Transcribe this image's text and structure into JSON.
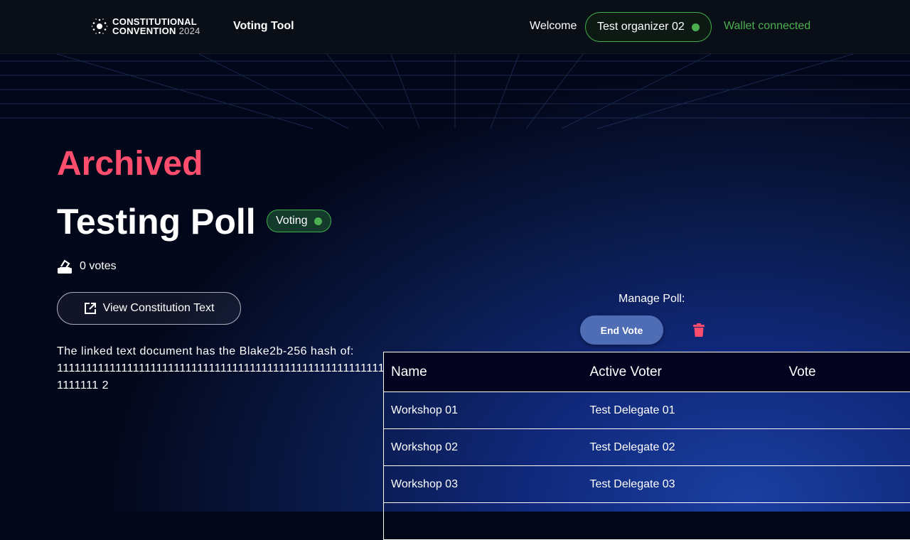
{
  "header": {
    "logo_line1": "CONSTITUTIONAL",
    "logo_line2": "CONVENTION",
    "logo_year": "2024",
    "app_name": "Voting Tool",
    "welcome": "Welcome",
    "user": "Test organizer 02",
    "wallet_status": "Wallet connected"
  },
  "poll": {
    "status_heading": "Archived",
    "title": "Testing Poll",
    "badge": "Voting",
    "votes": "0 votes",
    "view_button": "View Constitution Text",
    "hash_label": "The linked text document has the Blake2b-256 hash of:",
    "hash": "111111111111111111111111111111111111111111111111111111111111111 2"
  },
  "manage": {
    "label": "Manage Poll:",
    "end_vote": "End Vote"
  },
  "table": {
    "headers": [
      "Name",
      "Active Voter",
      "Vote"
    ],
    "rows": [
      [
        "Workshop 01",
        "Test Delegate 01",
        ""
      ],
      [
        "Workshop 02",
        "Test Delegate 02",
        ""
      ],
      [
        "Workshop 03",
        "Test Delegate 03",
        ""
      ],
      [
        "",
        "",
        ""
      ]
    ]
  },
  "colors": {
    "accent_red": "#ff4d6d",
    "green": "#4caf50",
    "button_blue": "#4f6db5"
  }
}
